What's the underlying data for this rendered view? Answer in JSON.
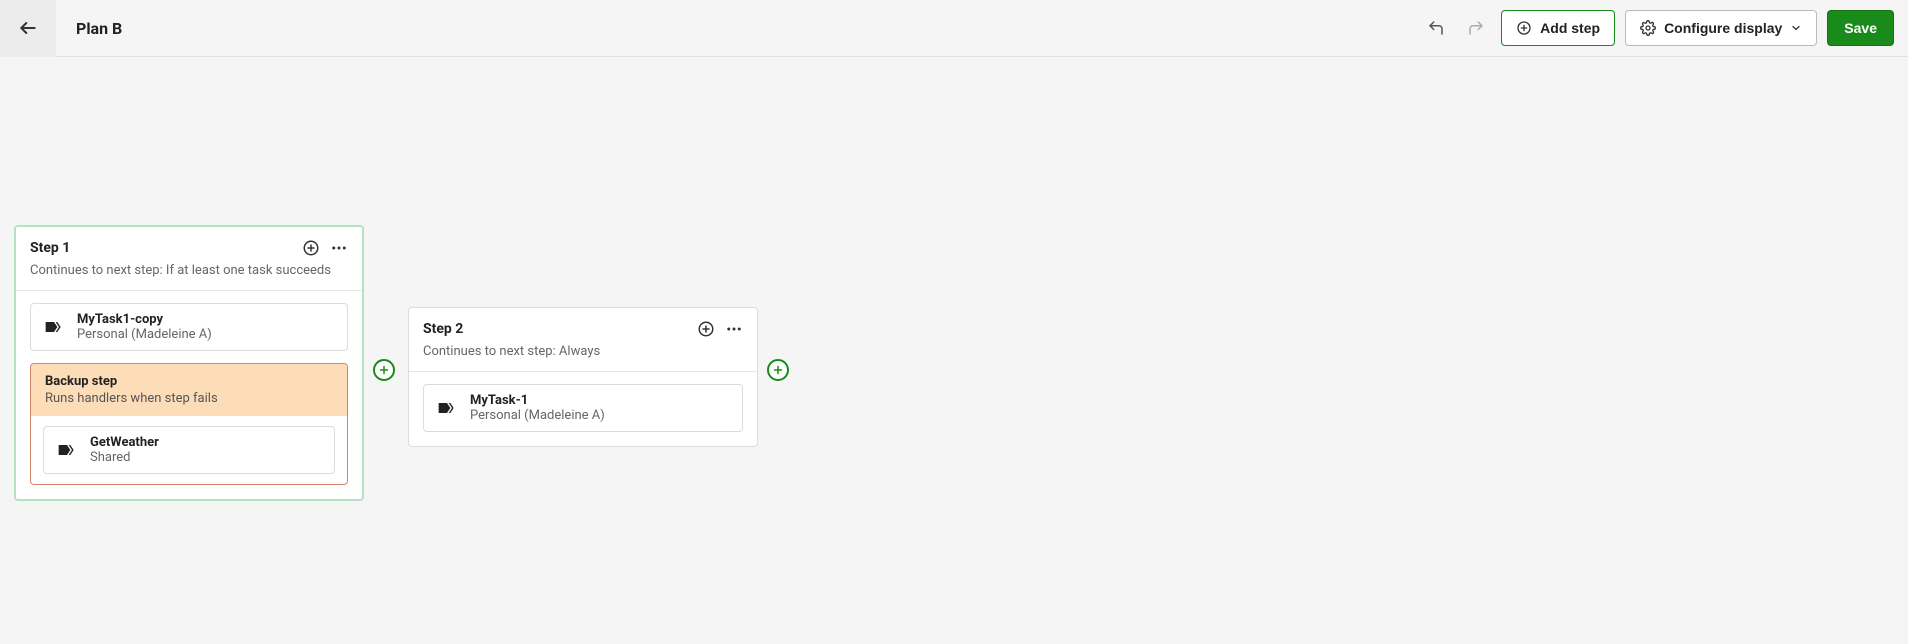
{
  "header": {
    "title": "Plan B",
    "add_step_label": "Add step",
    "configure_display_label": "Configure display",
    "save_label": "Save"
  },
  "steps": [
    {
      "title": "Step 1",
      "continues": "Continues to next step: If at least one task succeeds",
      "tasks": [
        {
          "name": "MyTask1-copy",
          "meta": "Personal (Madeleine A)"
        }
      ],
      "backup": {
        "title": "Backup step",
        "desc": "Runs handlers when step fails",
        "tasks": [
          {
            "name": "GetWeather",
            "meta": "Shared"
          }
        ]
      }
    },
    {
      "title": "Step 2",
      "continues": "Continues to next step: Always",
      "tasks": [
        {
          "name": "MyTask-1",
          "meta": "Personal (Madeleine A)"
        }
      ]
    }
  ]
}
